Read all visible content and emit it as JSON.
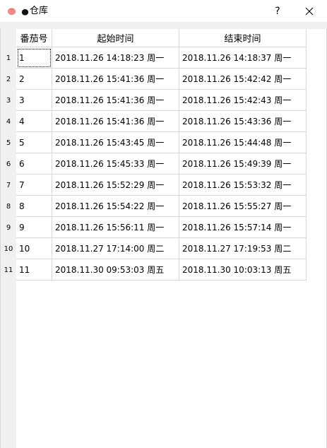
{
  "window": {
    "title": "仓库",
    "help_label": "?"
  },
  "table": {
    "headers": [
      "番茄号",
      "起始时间",
      "结束时间"
    ],
    "rows": [
      {
        "num": "1",
        "id": "1",
        "start": "2018.11.26 14:18:23 周一",
        "end": "2018.11.26 14:18:37 周一"
      },
      {
        "num": "2",
        "id": "2",
        "start": "2018.11.26 15:41:36 周一",
        "end": "2018.11.26 15:42:42 周一"
      },
      {
        "num": "3",
        "id": "3",
        "start": "2018.11.26 15:41:36 周一",
        "end": "2018.11.26 15:42:43 周一"
      },
      {
        "num": "4",
        "id": "4",
        "start": "2018.11.26 15:41:36 周一",
        "end": "2018.11.26 15:43:36 周一"
      },
      {
        "num": "5",
        "id": "5",
        "start": "2018.11.26 15:43:45 周一",
        "end": "2018.11.26 15:44:48 周一"
      },
      {
        "num": "6",
        "id": "6",
        "start": "2018.11.26 15:45:33 周一",
        "end": "2018.11.26 15:49:39 周一"
      },
      {
        "num": "7",
        "id": "7",
        "start": "2018.11.26 15:52:29 周一",
        "end": "2018.11.26 15:53:32 周一"
      },
      {
        "num": "8",
        "id": "8",
        "start": "2018.11.26 15:54:22 周一",
        "end": "2018.11.26 15:55:27 周一"
      },
      {
        "num": "9",
        "id": "9",
        "start": "2018.11.26 15:56:11 周一",
        "end": "2018.11.26 15:57:14 周一"
      },
      {
        "num": "10",
        "id": "10",
        "start": "2018.11.27 17:14:00 周二",
        "end": "2018.11.27 17:19:53 周二"
      },
      {
        "num": "11",
        "id": "11",
        "start": "2018.11.30 09:53:03 周五",
        "end": "2018.11.30 10:03:13 周五"
      }
    ]
  }
}
